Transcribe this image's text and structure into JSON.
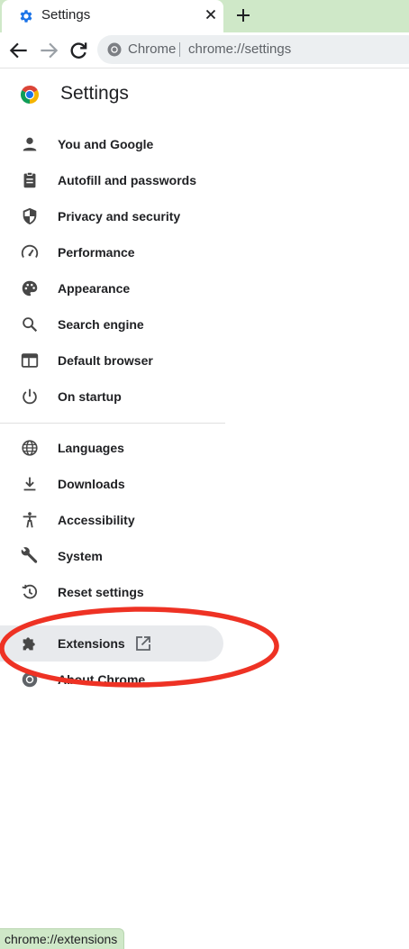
{
  "browser": {
    "tab": {
      "title": "Settings",
      "icon": "gear-icon"
    },
    "new_tab_icon": "plus-icon",
    "omnibox": {
      "chip": "Chrome",
      "url": "chrome://settings"
    },
    "status_url": "chrome://extensions",
    "theme_color": "#cfe8c8"
  },
  "settings": {
    "title": "Settings",
    "menu_primary": [
      {
        "label": "You and Google",
        "icon": "person-icon"
      },
      {
        "label": "Autofill and passwords",
        "icon": "clipboard-icon"
      },
      {
        "label": "Privacy and security",
        "icon": "shield-icon"
      },
      {
        "label": "Performance",
        "icon": "speedometer-icon"
      },
      {
        "label": "Appearance",
        "icon": "palette-icon"
      },
      {
        "label": "Search engine",
        "icon": "search-icon"
      },
      {
        "label": "Default browser",
        "icon": "browser-window-icon"
      },
      {
        "label": "On startup",
        "icon": "power-icon"
      }
    ],
    "menu_secondary": [
      {
        "label": "Languages",
        "icon": "globe-icon"
      },
      {
        "label": "Downloads",
        "icon": "download-icon"
      },
      {
        "label": "Accessibility",
        "icon": "accessibility-icon"
      },
      {
        "label": "System",
        "icon": "wrench-icon"
      },
      {
        "label": "Reset settings",
        "icon": "history-icon"
      },
      {
        "label": "Extensions",
        "icon": "puzzle-icon",
        "highlighted": true
      },
      {
        "label": "About Chrome",
        "icon": "chrome-logo-icon"
      }
    ]
  },
  "annotation_color": "#ee3224"
}
